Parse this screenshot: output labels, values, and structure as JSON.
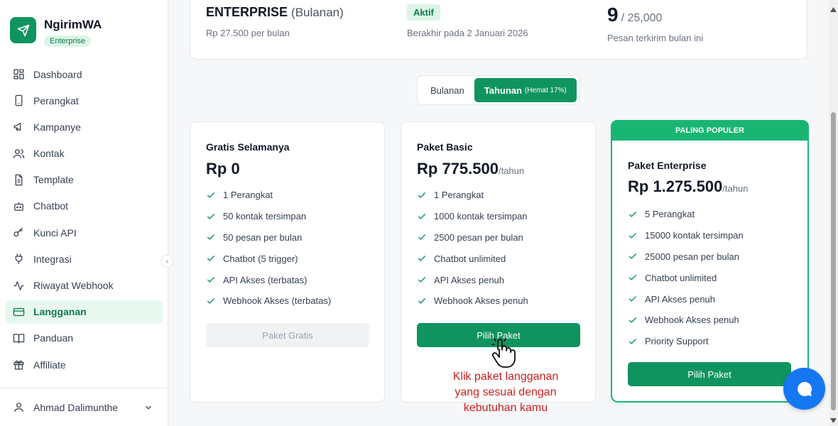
{
  "app": {
    "name": "NgirimWA",
    "plan_badge": "Enterprise"
  },
  "sidebar": {
    "items": [
      {
        "label": "Dashboard",
        "icon": "dashboard-icon"
      },
      {
        "label": "Perangkat",
        "icon": "phone-icon"
      },
      {
        "label": "Kampanye",
        "icon": "megaphone-icon"
      },
      {
        "label": "Kontak",
        "icon": "users-icon"
      },
      {
        "label": "Template",
        "icon": "file-icon"
      },
      {
        "label": "Chatbot",
        "icon": "bot-icon"
      },
      {
        "label": "Kunci API",
        "icon": "key-icon"
      },
      {
        "label": "Integrasi",
        "icon": "plug-icon"
      },
      {
        "label": "Riwayat Webhook",
        "icon": "activity-icon"
      },
      {
        "label": "Langganan",
        "icon": "credit-card-icon",
        "active": true
      },
      {
        "label": "Panduan",
        "icon": "book-icon"
      },
      {
        "label": "Affiliate",
        "icon": "gift-icon"
      }
    ],
    "user": {
      "name": "Ahmad Dalimunthe"
    }
  },
  "current_plan": {
    "name": "ENTERPRISE",
    "period": "(Bulanan)",
    "price": "Rp 27.500 per bulan",
    "status": "Aktif",
    "expiry": "Berakhir pada 2 Januari 2026",
    "usage_count": "9",
    "usage_limit": "/ 25,000",
    "usage_label": "Pesan terkirim bulan ini"
  },
  "billing_toggle": {
    "monthly": "Bulanan",
    "yearly": "Tahunan",
    "yearly_save": "(Hemat 17%)",
    "selected": "yearly"
  },
  "plans": [
    {
      "name": "Gratis Selamanya",
      "price": "Rp 0",
      "per": "",
      "features": [
        "1 Perangkat",
        "50 kontak tersimpan",
        "50 pesan per bulan",
        "Chatbot (5 trigger)",
        "API Akses (terbatas)",
        "Webhook Akses (terbatas)"
      ],
      "button": "Paket Gratis"
    },
    {
      "name": "Paket Basic",
      "price": "Rp 775.500",
      "per": "/tahun",
      "features": [
        "1 Perangkat",
        "1000 kontak tersimpan",
        "2500 pesan per bulan",
        "Chatbot unlimited",
        "API Akses penuh",
        "Webhook Akses penuh"
      ],
      "button": "Pilih Paket"
    },
    {
      "name": "Paket Enterprise",
      "price": "Rp 1.275.500",
      "per": "/tahun",
      "banner": "PALING POPULER",
      "features": [
        "5 Perangkat",
        "15000 kontak tersimpan",
        "25000 pesan per bulan",
        "Chatbot unlimited",
        "API Akses penuh",
        "Webhook Akses penuh",
        "Priority Support"
      ],
      "button": "Pilih Paket"
    }
  ],
  "annotation": "Klik paket langganan yang sesuai dengan kebutuhan kamu",
  "colors": {
    "brand": "#0f9460",
    "popular": "#19b673",
    "annotation": "#cc1f1f",
    "chat": "#1677f2"
  }
}
